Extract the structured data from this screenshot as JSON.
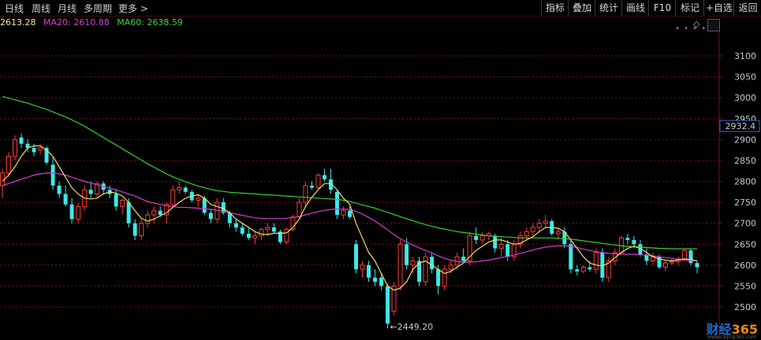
{
  "tabs": [
    {
      "label": "日线",
      "active": true
    },
    {
      "label": "周线",
      "active": false
    },
    {
      "label": "月线",
      "active": false
    },
    {
      "label": "多周期",
      "active": false
    },
    {
      "label": "更多 >",
      "active": false
    }
  ],
  "toolbar": [
    "指标",
    "叠加",
    "统计",
    "画线",
    "F10",
    "标记",
    "+自选",
    "返回"
  ],
  "ma_legend": [
    {
      "text": "2613.28",
      "color": "#e8e8a0"
    },
    {
      "text": "MA20: 2610.88",
      "color": "#d040d0"
    },
    {
      "text": "MA60: 2638.59",
      "color": "#40d040"
    }
  ],
  "price_axis": [
    "3100",
    "3050",
    "3000",
    "2950",
    "2900",
    "2850",
    "2800",
    "2750",
    "2700",
    "2650",
    "2600",
    "2550",
    "2500"
  ],
  "current_price_tag": "2932.4",
  "low_annotation": "2449.20",
  "watermark": {
    "part1": "财经",
    "part2": "365",
    "url": "www.caijing365.com"
  },
  "colors": {
    "up": "#ff3b3b",
    "down": "#3ee8e8",
    "ma5": "#e8e8e8",
    "ma10": "#e8e060",
    "ma20": "#d040d0",
    "ma60": "#30d030",
    "grid": "#7a1010"
  },
  "chart_data": {
    "type": "candlestick",
    "ylim": [
      2440,
      3140
    ],
    "ohlc": [
      [
        2790,
        2830,
        2760,
        2820
      ],
      [
        2820,
        2870,
        2810,
        2860
      ],
      [
        2860,
        2910,
        2850,
        2900
      ],
      [
        2905,
        2915,
        2880,
        2890
      ],
      [
        2890,
        2900,
        2870,
        2880
      ],
      [
        2880,
        2890,
        2860,
        2870
      ],
      [
        2875,
        2890,
        2865,
        2880
      ],
      [
        2880,
        2885,
        2840,
        2845
      ],
      [
        2840,
        2860,
        2780,
        2790
      ],
      [
        2790,
        2800,
        2760,
        2770
      ],
      [
        2770,
        2790,
        2740,
        2745
      ],
      [
        2745,
        2760,
        2700,
        2710
      ],
      [
        2710,
        2750,
        2700,
        2740
      ],
      [
        2740,
        2790,
        2730,
        2780
      ],
      [
        2780,
        2800,
        2760,
        2770
      ],
      [
        2770,
        2800,
        2760,
        2795
      ],
      [
        2795,
        2800,
        2770,
        2780
      ],
      [
        2780,
        2790,
        2760,
        2770
      ],
      [
        2770,
        2780,
        2730,
        2740
      ],
      [
        2740,
        2760,
        2720,
        2755
      ],
      [
        2750,
        2760,
        2690,
        2700
      ],
      [
        2700,
        2710,
        2660,
        2670
      ],
      [
        2670,
        2710,
        2660,
        2700
      ],
      [
        2700,
        2730,
        2690,
        2720
      ],
      [
        2720,
        2740,
        2700,
        2730
      ],
      [
        2730,
        2740,
        2715,
        2720
      ],
      [
        2720,
        2750,
        2700,
        2745
      ],
      [
        2745,
        2790,
        2740,
        2780
      ],
      [
        2780,
        2800,
        2770,
        2785
      ],
      [
        2785,
        2790,
        2770,
        2775
      ],
      [
        2775,
        2780,
        2750,
        2755
      ],
      [
        2755,
        2770,
        2740,
        2760
      ],
      [
        2760,
        2765,
        2720,
        2725
      ],
      [
        2725,
        2735,
        2700,
        2710
      ],
      [
        2710,
        2760,
        2700,
        2750
      ],
      [
        2750,
        2760,
        2720,
        2725
      ],
      [
        2725,
        2730,
        2690,
        2700
      ],
      [
        2700,
        2710,
        2680,
        2690
      ],
      [
        2690,
        2700,
        2670,
        2675
      ],
      [
        2675,
        2690,
        2660,
        2665
      ],
      [
        2665,
        2680,
        2650,
        2670
      ],
      [
        2670,
        2690,
        2660,
        2685
      ],
      [
        2685,
        2700,
        2670,
        2690
      ],
      [
        2690,
        2700,
        2675,
        2680
      ],
      [
        2680,
        2685,
        2650,
        2655
      ],
      [
        2655,
        2690,
        2650,
        2685
      ],
      [
        2685,
        2720,
        2680,
        2715
      ],
      [
        2715,
        2760,
        2710,
        2750
      ],
      [
        2750,
        2800,
        2740,
        2790
      ],
      [
        2790,
        2800,
        2780,
        2785
      ],
      [
        2785,
        2820,
        2780,
        2815
      ],
      [
        2815,
        2830,
        2800,
        2805
      ],
      [
        2805,
        2830,
        2770,
        2780
      ],
      [
        2775,
        2780,
        2710,
        2720
      ],
      [
        2720,
        2740,
        2710,
        2730
      ],
      [
        2730,
        2740,
        2710,
        2715
      ],
      [
        2650,
        2660,
        2580,
        2590
      ],
      [
        2590,
        2610,
        2570,
        2600
      ],
      [
        2600,
        2610,
        2560,
        2570
      ],
      [
        2570,
        2590,
        2550,
        2560
      ],
      [
        2570,
        2580,
        2540,
        2550
      ],
      [
        2550,
        2555,
        2449,
        2460
      ],
      [
        2490,
        2560,
        2480,
        2550
      ],
      [
        2550,
        2660,
        2540,
        2650
      ],
      [
        2650,
        2665,
        2590,
        2600
      ],
      [
        2600,
        2620,
        2580,
        2610
      ],
      [
        2610,
        2620,
        2550,
        2560
      ],
      [
        2560,
        2630,
        2550,
        2620
      ],
      [
        2620,
        2630,
        2580,
        2590
      ],
      [
        2590,
        2600,
        2530,
        2550
      ],
      [
        2550,
        2600,
        2540,
        2590
      ],
      [
        2590,
        2610,
        2580,
        2600
      ],
      [
        2600,
        2630,
        2590,
        2620
      ],
      [
        2620,
        2640,
        2605,
        2610
      ],
      [
        2610,
        2680,
        2600,
        2670
      ],
      [
        2670,
        2690,
        2650,
        2660
      ],
      [
        2660,
        2680,
        2650,
        2670
      ],
      [
        2670,
        2680,
        2660,
        2675
      ],
      [
        2670,
        2675,
        2630,
        2640
      ],
      [
        2640,
        2665,
        2620,
        2650
      ],
      [
        2650,
        2660,
        2610,
        2620
      ],
      [
        2620,
        2660,
        2610,
        2650
      ],
      [
        2650,
        2680,
        2640,
        2670
      ],
      [
        2670,
        2690,
        2660,
        2680
      ],
      [
        2680,
        2700,
        2670,
        2690
      ],
      [
        2690,
        2710,
        2680,
        2700
      ],
      [
        2700,
        2720,
        2690,
        2705
      ],
      [
        2705,
        2710,
        2670,
        2675
      ],
      [
        2675,
        2690,
        2660,
        2680
      ],
      [
        2680,
        2690,
        2640,
        2650
      ],
      [
        2650,
        2660,
        2580,
        2590
      ],
      [
        2590,
        2600,
        2575,
        2585
      ],
      [
        2585,
        2600,
        2580,
        2595
      ],
      [
        2595,
        2610,
        2585,
        2590
      ],
      [
        2590,
        2640,
        2580,
        2630
      ],
      [
        2630,
        2640,
        2560,
        2570
      ],
      [
        2570,
        2620,
        2560,
        2610
      ],
      [
        2610,
        2640,
        2600,
        2630
      ],
      [
        2630,
        2670,
        2625,
        2665
      ],
      [
        2665,
        2675,
        2650,
        2660
      ],
      [
        2660,
        2670,
        2640,
        2650
      ],
      [
        2650,
        2660,
        2620,
        2625
      ],
      [
        2625,
        2640,
        2600,
        2610
      ],
      [
        2610,
        2630,
        2600,
        2620
      ],
      [
        2620,
        2625,
        2590,
        2595
      ],
      [
        2595,
        2610,
        2585,
        2605
      ],
      [
        2605,
        2615,
        2600,
        2608
      ],
      [
        2608,
        2620,
        2600,
        2615
      ],
      [
        2615,
        2640,
        2610,
        2635
      ],
      [
        2635,
        2640,
        2600,
        2605
      ],
      [
        2605,
        2610,
        2580,
        2595
      ]
    ],
    "ma5": [
      2800,
      2815,
      2835,
      2860,
      2880,
      2885,
      2885,
      2875,
      2860,
      2835,
      2810,
      2785,
      2770,
      2760,
      2758,
      2760,
      2770,
      2775,
      2772,
      2765,
      2750,
      2730,
      2712,
      2705,
      2710,
      2718,
      2725,
      2738,
      2750,
      2760,
      2765,
      2768,
      2760,
      2745,
      2740,
      2735,
      2725,
      2710,
      2700,
      2690,
      2680,
      2674,
      2673,
      2676,
      2676,
      2677,
      2690,
      2710,
      2740,
      2762,
      2780,
      2795,
      2795,
      2780,
      2760,
      2745,
      2700,
      2665,
      2630,
      2610,
      2580,
      2550,
      2540,
      2545,
      2560,
      2590,
      2605,
      2610,
      2600,
      2590,
      2580,
      2585,
      2595,
      2605,
      2620,
      2635,
      2645,
      2655,
      2660,
      2660,
      2655,
      2650,
      2652,
      2660,
      2668,
      2680,
      2690,
      2690,
      2688,
      2680,
      2660,
      2640,
      2620,
      2605,
      2600,
      2598,
      2605,
      2618,
      2630,
      2640,
      2645,
      2640,
      2630,
      2620,
      2615,
      2612,
      2610,
      2612,
      2615,
      2613,
      2610
    ],
    "ma20": [
      2790,
      2795,
      2800,
      2805,
      2810,
      2815,
      2818,
      2820,
      2820,
      2818,
      2815,
      2810,
      2805,
      2800,
      2796,
      2792,
      2788,
      2784,
      2780,
      2775,
      2770,
      2765,
      2758,
      2752,
      2748,
      2745,
      2742,
      2740,
      2738,
      2738,
      2737,
      2736,
      2735,
      2733,
      2731,
      2728,
      2725,
      2722,
      2719,
      2716,
      2713,
      2712,
      2711,
      2711,
      2711,
      2712,
      2714,
      2716,
      2720,
      2724,
      2728,
      2731,
      2733,
      2734,
      2734,
      2733,
      2728,
      2722,
      2714,
      2705,
      2695,
      2684,
      2673,
      2663,
      2655,
      2648,
      2641,
      2635,
      2629,
      2622,
      2616,
      2612,
      2609,
      2607,
      2607,
      2608,
      2610,
      2612,
      2615,
      2618,
      2621,
      2624,
      2628,
      2632,
      2636,
      2640,
      2643,
      2645,
      2646,
      2646,
      2645,
      2642,
      2638,
      2635,
      2632,
      2630,
      2628,
      2627,
      2626,
      2626,
      2626,
      2625,
      2624,
      2622,
      2620,
      2618,
      2616,
      2614,
      2612,
      2611,
      2611
    ],
    "ma60": [
      3003,
      2999,
      2995,
      2991,
      2987,
      2982,
      2977,
      2972,
      2966,
      2960,
      2954,
      2947,
      2940,
      2932,
      2923,
      2914,
      2905,
      2896,
      2887,
      2878,
      2869,
      2860,
      2851,
      2842,
      2834,
      2826,
      2818,
      2811,
      2805,
      2799,
      2794,
      2789,
      2785,
      2781,
      2778,
      2776,
      2774,
      2773,
      2772,
      2771,
      2770,
      2769,
      2768,
      2767,
      2766,
      2765,
      2764,
      2763,
      2762,
      2761,
      2760,
      2759,
      2758,
      2757,
      2755,
      2752,
      2748,
      2744,
      2740,
      2736,
      2731,
      2726,
      2721,
      2716,
      2711,
      2706,
      2701,
      2697,
      2693,
      2689,
      2686,
      2683,
      2680,
      2678,
      2676,
      2674,
      2672,
      2670,
      2669,
      2668,
      2667,
      2666,
      2665,
      2665,
      2665,
      2665,
      2665,
      2665,
      2664,
      2663,
      2662,
      2660,
      2658,
      2656,
      2654,
      2652,
      2650,
      2648,
      2646,
      2645,
      2644,
      2643,
      2642,
      2641,
      2640,
      2640,
      2639,
      2639,
      2639,
      2639,
      2639
    ]
  }
}
